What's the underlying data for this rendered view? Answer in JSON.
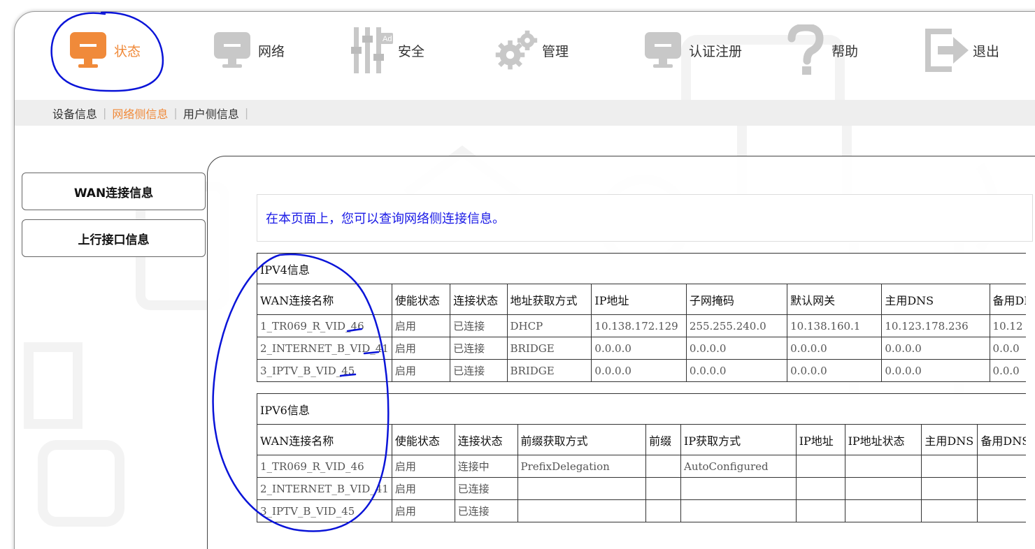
{
  "nav": {
    "items": [
      {
        "label": "状态",
        "icon": "monitor-icon",
        "active": true
      },
      {
        "label": "网络",
        "icon": "monitor-icon",
        "active": false
      },
      {
        "label": "安全",
        "icon": "sliders-icon",
        "active": false
      },
      {
        "label": "管理",
        "icon": "gears-icon",
        "active": false
      },
      {
        "label": "认证注册",
        "icon": "monitor-icon",
        "active": false
      },
      {
        "label": "帮助",
        "icon": "question-icon",
        "active": false
      },
      {
        "label": "退出",
        "icon": "logout-icon",
        "active": false
      }
    ]
  },
  "subnav": {
    "items": [
      "设备信息",
      "网络侧信息",
      "用户侧信息"
    ],
    "active": "网络侧信息"
  },
  "sidebar": {
    "items": [
      "WAN连接信息",
      "上行接口信息"
    ]
  },
  "info_text": "在本页面上，您可以查询网络侧连接信息。",
  "ipv4": {
    "caption": "IPV4信息",
    "headers": [
      "WAN连接名称",
      "使能状态",
      "连接状态",
      "地址获取方式",
      "IP地址",
      "子网掩码",
      "默认网关",
      "主用DNS",
      "备用DNS"
    ],
    "rows": [
      [
        "1_TR069_R_VID_46",
        "启用",
        "已连接",
        "DHCP",
        "10.138.172.129",
        "255.255.240.0",
        "10.138.160.1",
        "10.123.178.236",
        "10.12"
      ],
      [
        "2_INTERNET_B_VID_41",
        "启用",
        "已连接",
        "BRIDGE",
        "0.0.0.0",
        "0.0.0.0",
        "0.0.0.0",
        "0.0.0.0",
        "0.0.0"
      ],
      [
        "3_IPTV_B_VID_45",
        "启用",
        "已连接",
        "BRIDGE",
        "0.0.0.0",
        "0.0.0.0",
        "0.0.0.0",
        "0.0.0.0",
        "0.0.0"
      ]
    ]
  },
  "ipv6": {
    "caption": "IPV6信息",
    "headers": [
      "WAN连接名称",
      "使能状态",
      "连接状态",
      "前缀获取方式",
      "前缀",
      "IP获取方式",
      "IP地址",
      "IP地址状态",
      "主用DNS",
      "备用DNS"
    ],
    "rows": [
      [
        "1_TR069_R_VID_46",
        "启用",
        "连接中",
        "PrefixDelegation",
        "",
        "AutoConfigured",
        "",
        "",
        "",
        ""
      ],
      [
        "2_INTERNET_B_VID_41",
        "启用",
        "已连接",
        "",
        "",
        "",
        "",
        "",
        "",
        ""
      ],
      [
        "3_IPTV_B_VID_45",
        "启用",
        "已连接",
        "",
        "",
        "",
        "",
        "",
        "",
        ""
      ]
    ]
  },
  "colors": {
    "accent": "#f08a3a",
    "icon_gray": "#c8c8c8",
    "info_blue": "#1a1ae6",
    "annotation_blue": "#0a14d8"
  }
}
